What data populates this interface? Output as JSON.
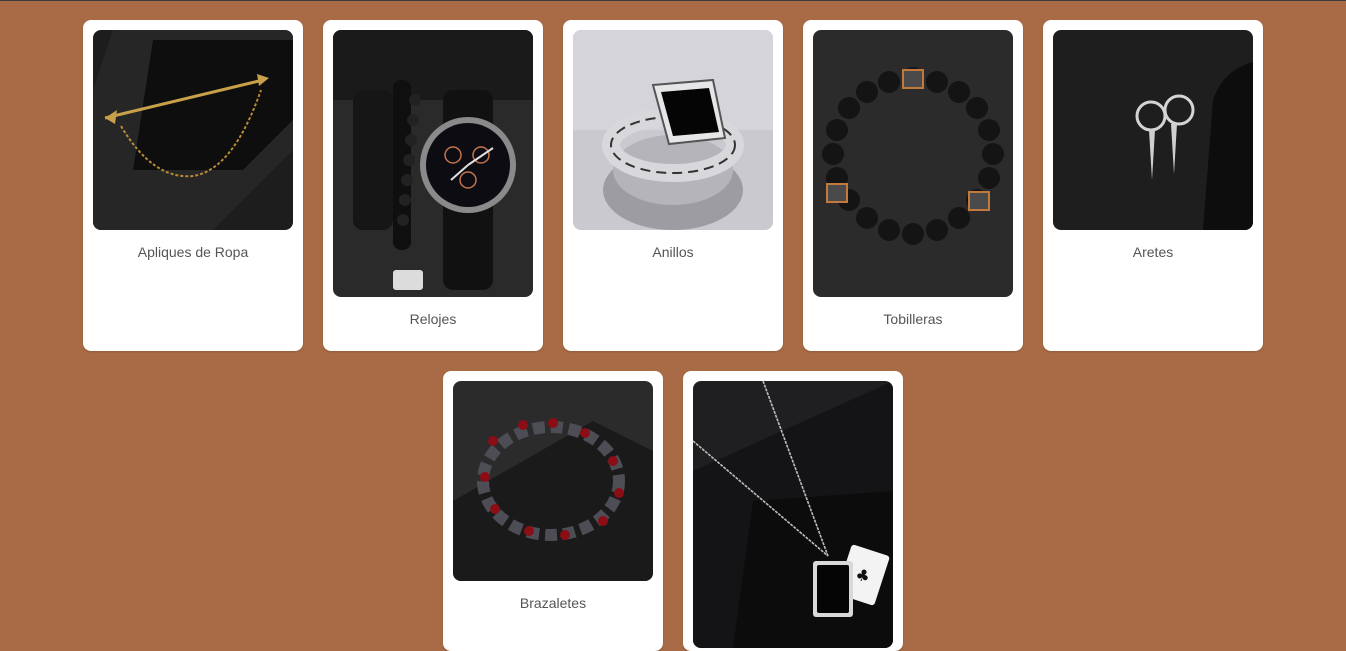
{
  "colors": {
    "background": "#a86b45",
    "card": "#ffffff",
    "label": "#555555"
  },
  "categories": [
    {
      "label": "Apliques de Ropa",
      "image": "gold-arrow-collar-pin-icon"
    },
    {
      "label": "Relojes",
      "image": "black-watch-and-bracelets-icon"
    },
    {
      "label": "Anillos",
      "image": "silver-black-signet-ring-icon"
    },
    {
      "label": "Tobilleras",
      "image": "black-bead-bracelet-icon"
    },
    {
      "label": "Aretes",
      "image": "silver-hoop-spike-earrings-icon"
    },
    {
      "label": "Brazaletes",
      "image": "hematite-red-bead-bracelet-icon"
    },
    {
      "label": "",
      "image": "ace-card-pendant-necklace-icon"
    }
  ]
}
